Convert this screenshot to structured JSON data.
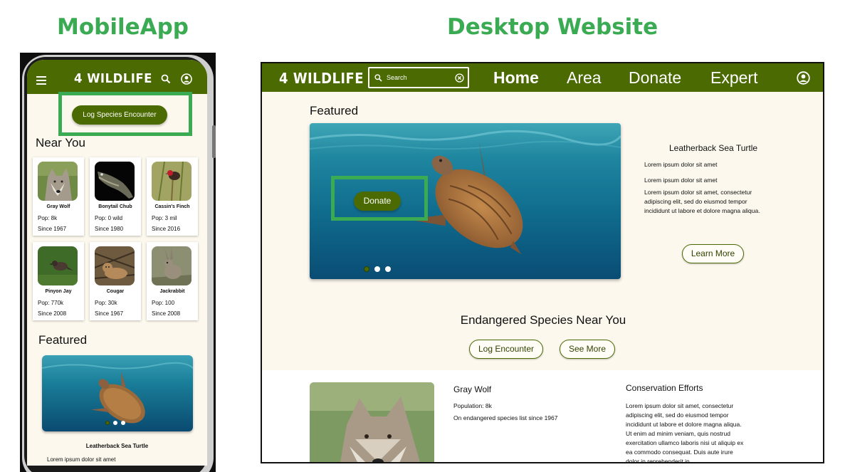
{
  "headings": {
    "mobile": "MobileApp",
    "desktop": "Desktop Website"
  },
  "colors": {
    "brand_green": "#4b6a02",
    "highlight_green": "#3bab53",
    "page_bg": "#fcf8ee"
  },
  "mobile": {
    "logo": "4 WILDLIFE",
    "icons": [
      "hamburger-icon",
      "search-icon",
      "profile-icon"
    ],
    "log_button": "Log Species Encounter",
    "near_you_title": "Near You",
    "species": [
      {
        "name": "Gray Wolf",
        "pop": "Pop: 8k",
        "since": "Since 1967"
      },
      {
        "name": "Bonytail Chub",
        "pop": "Pop: 0 wild",
        "since": "Since 1980"
      },
      {
        "name": "Cassin's Finch",
        "pop": "Pop: 3 mil",
        "since": "Since 2016"
      },
      {
        "name": "Pinyon Jay",
        "pop": "Pop: 770k",
        "since": "Since 2008"
      },
      {
        "name": "Cougar",
        "pop": "Pop: 30k",
        "since": "Since 1967"
      },
      {
        "name": "Jackrabbit",
        "pop": "Pop: 100",
        "since": "Since 2008"
      }
    ],
    "featured_title": "Featured",
    "featured_caption": "Leatherback Sea Turtle",
    "featured_text": "Lorem ipsum dolor sit amet"
  },
  "desktop": {
    "logo": "4 WILDLIFE",
    "search_placeholder": "Search",
    "nav": {
      "home": "Home",
      "area": "Area",
      "donate": "Donate",
      "expert": "Expert"
    },
    "featured_title": "Featured",
    "donate_button": "Donate",
    "side": {
      "title": "Leatherback Sea Turtle",
      "line1": "Lorem ipsum dolor sit amet",
      "line2": "Lorem ipsum dolor sit amet",
      "para": "Lorem ipsum dolor sit amet, consectetur adipiscing elit, sed do eiusmod tempor incididunt ut labore et dolore magna aliqua.",
      "learn_more": "Learn More"
    },
    "carousel": {
      "slides": 3,
      "active": 1
    },
    "endangered_title": "Endangered Species Near You",
    "log_encounter": "Log Encounter",
    "see_more": "See More",
    "wolf": {
      "name": "Gray Wolf",
      "population": "Population: 8k",
      "since": "On endangered species list since 1967"
    },
    "conservation": {
      "title": "Conservation Efforts",
      "text": "Lorem ipsum dolor sit amet, consectetur adipiscing elit, sed do eiusmod tempor incididunt ut labore et dolore magna aliqua. Ut enim ad minim veniam, quis nostrud exercitation ullamco laboris nisi ut aliquip ex ea commodo consequat. Duis aute irure dolor in reprehenderit in"
    }
  }
}
